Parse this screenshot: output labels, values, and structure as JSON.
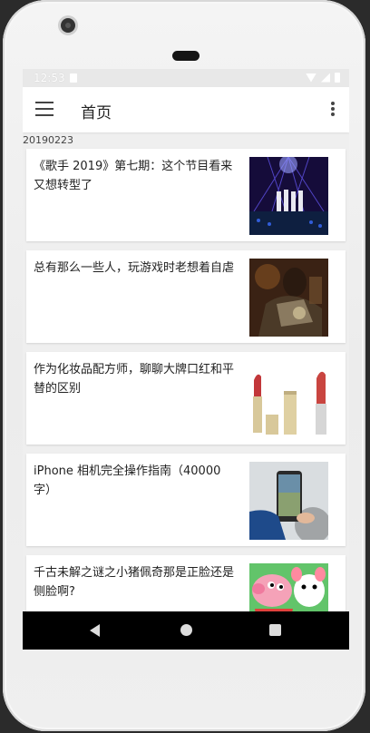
{
  "status": {
    "time": "12:53"
  },
  "appbar": {
    "title": "首页"
  },
  "feed": {
    "date": "20190223",
    "articles": [
      {
        "title": "《歌手 2019》第七期：这个节目看来又想转型了",
        "image": "concert-stage-image"
      },
      {
        "title": "总有那么一些人，玩游戏时老想着自虐",
        "image": "armored-character-image"
      },
      {
        "title": "作为化妆品配方师，聊聊大牌口红和平替的区别",
        "image": "lipsticks-image"
      },
      {
        "title": "iPhone 相机完全操作指南（40000 字）",
        "image": "phone-camera-image"
      },
      {
        "title": "千古未解之谜之小猪佩奇那是正脸还是侧脸啊?",
        "image": "peppa-pig-image"
      }
    ]
  },
  "colors": {
    "appbar": "#ffffff",
    "background": "#efefef",
    "navbar": "#000000"
  }
}
